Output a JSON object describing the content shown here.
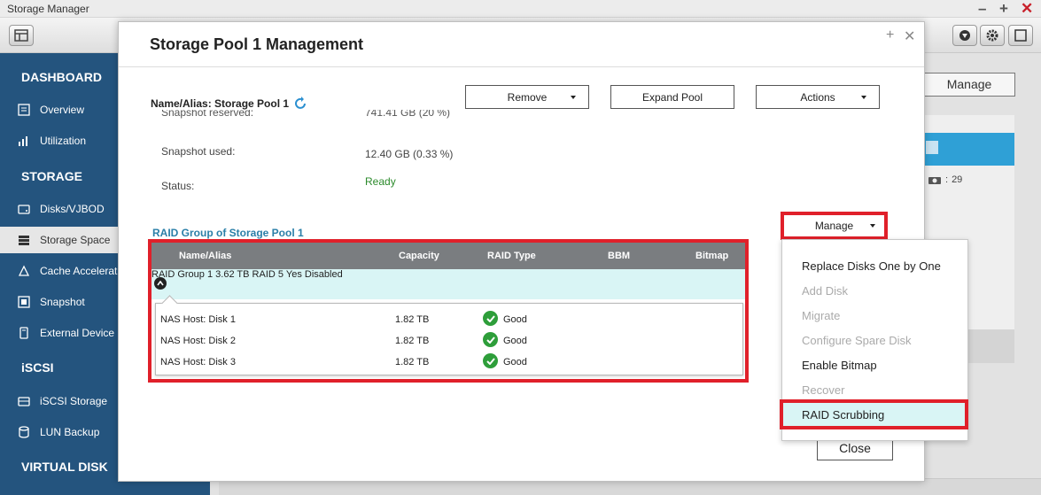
{
  "app": {
    "title": "Storage Manager"
  },
  "sidebar": {
    "sections": [
      {
        "label": "DASHBOARD"
      },
      {
        "label": "STORAGE"
      },
      {
        "label": "iSCSI"
      },
      {
        "label": "VIRTUAL DISK"
      }
    ],
    "items": [
      {
        "label": "Overview",
        "icon": "overview-icon"
      },
      {
        "label": "Utilization",
        "icon": "utilization-icon"
      },
      {
        "label": "Disks/VJBOD",
        "icon": "disk-icon"
      },
      {
        "label": "Storage Space",
        "icon": "storage-space-icon"
      },
      {
        "label": "Cache Acceleration",
        "icon": "cache-icon"
      },
      {
        "label": "Snapshot",
        "icon": "snapshot-icon"
      },
      {
        "label": "External Device",
        "icon": "external-device-icon"
      },
      {
        "label": "iSCSI Storage",
        "icon": "iscsi-storage-icon"
      },
      {
        "label": "LUN Backup",
        "icon": "lun-backup-icon"
      }
    ]
  },
  "background": {
    "manage_label": "Manage",
    "snapshot_count": "29"
  },
  "modal": {
    "title": "Storage Pool 1 Management",
    "name_alias": "Name/Alias: Storage Pool 1",
    "buttons": {
      "remove": "Remove",
      "expand": "Expand Pool",
      "actions": "Actions"
    },
    "info": {
      "snapshot_reserved_label": "Snapshot reserved:",
      "snapshot_reserved_value": "741.41 GB (20 %)",
      "snapshot_used_label": "Snapshot used:",
      "snapshot_used_value": "12.40 GB (0.33 %)",
      "status_label": "Status:",
      "status_value": "Ready"
    },
    "raid_heading": "RAID Group of Storage Pool 1",
    "manage_label": "Manage",
    "close_label": "Close",
    "table": {
      "headers": [
        "Name/Alias",
        "Capacity",
        "RAID Type",
        "BBM",
        "Bitmap"
      ],
      "group": {
        "name": "RAID Group 1",
        "capacity": "3.62 TB",
        "raid_type": "RAID 5",
        "bbm": "Yes",
        "bitmap": "Disabled"
      },
      "disks": [
        {
          "name": "NAS Host: Disk 1",
          "capacity": "1.82 TB",
          "status": "Good"
        },
        {
          "name": "NAS Host: Disk 2",
          "capacity": "1.82 TB",
          "status": "Good"
        },
        {
          "name": "NAS Host: Disk 3",
          "capacity": "1.82 TB",
          "status": "Good"
        }
      ]
    }
  },
  "manage_menu": {
    "items": [
      {
        "label": "Replace Disks One by One",
        "enabled": true
      },
      {
        "label": "Add Disk",
        "enabled": false
      },
      {
        "label": "Migrate",
        "enabled": false
      },
      {
        "label": "Configure Spare Disk",
        "enabled": false
      },
      {
        "label": "Enable Bitmap",
        "enabled": true
      },
      {
        "label": "Recover",
        "enabled": false
      },
      {
        "label": "RAID Scrubbing",
        "enabled": true,
        "highlighted": true
      }
    ]
  },
  "colors": {
    "sidebar": "#24547e",
    "highlight_border": "#e0202a",
    "accent_link": "#2a7fa8",
    "status_good": "#2e9e3a",
    "row_highlight": "#d9f5f5"
  }
}
